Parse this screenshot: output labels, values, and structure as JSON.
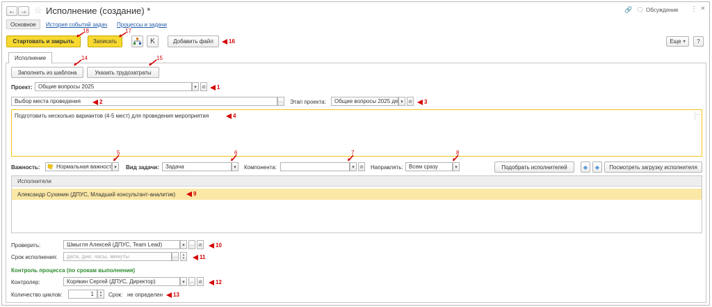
{
  "window": {
    "title": "Исполнение (создание) *",
    "discussion_label": "Обсуждение"
  },
  "nav_tabs": [
    {
      "label": "Основное"
    },
    {
      "label": "История событий задач"
    },
    {
      "label": "Процессы и задачи"
    }
  ],
  "toolbar": {
    "start_close_label": "Стартовать и закрыть",
    "save_label": "Записать",
    "k_label": "K",
    "add_file_label": "Добавить файл",
    "more_label": "Еще",
    "help_label": "?"
  },
  "form_tab": {
    "label": "Исполнение"
  },
  "buttons": {
    "fill_template": "Заполнить из шаблона",
    "labor_costs": "Указать трудозатраты",
    "pick_executors": "Подобрать исполнителей",
    "view_load": "Посмотреть загрузку исполнителя"
  },
  "fields": {
    "project_label": "Проект:",
    "project_value": "Общие вопросы 2025",
    "task_name_value": "Выбор места проведения",
    "project_stage_label": "Этап проекта:",
    "project_stage_value": "Общие вопросы 2025 де",
    "description_value": "Подготовить несколько вариантов (4-5 мест) для проведения мероприятия",
    "importance_label": "Важность:",
    "importance_value": "Нормальная важност",
    "task_type_label": "Вид задачи:",
    "task_type_value": "Задача",
    "component_label": "Компонента:",
    "component_value": "",
    "direct_label": "Направлять:",
    "direct_value": "Всем сразу",
    "check_label": "Проверить:",
    "check_value": "Шмыгля Алексей (ДПУС, Team Lead)",
    "deadline_label": "Срок исполнения:",
    "deadline_placeholder": "дата, дни, часы, минуты",
    "control_section": "Контроль процесса (по срокам выполнения)",
    "controller_label": "Контролер:",
    "controller_value": "Корякин Сергей (ДПУС, Директор)",
    "cycles_label": "Количество циклов:",
    "cycles_value": "1",
    "term_label": "Срок:",
    "term_value": "не определен"
  },
  "executors": {
    "header": "Исполнители",
    "rows": [
      {
        "text": "Александр Сухинин (ДПУС, Младший консультант-аналитик)"
      }
    ]
  },
  "markers": {
    "m1": "1",
    "m2": "2",
    "m3": "3",
    "m4": "4",
    "m5": "5",
    "m6": "6",
    "m7": "7",
    "m8": "8",
    "m9": "9",
    "m10": "10",
    "m11": "11",
    "m12": "12",
    "m13": "13",
    "m14": "14",
    "m15": "15",
    "m16": "16",
    "m17": "17",
    "m18": "18"
  },
  "colors": {
    "accent_yellow": "#f7d931",
    "marker_red": "#d40000",
    "selected_row": "#fbe7a6",
    "section_green": "#2e8b2e",
    "link_blue": "#1f5aa6"
  }
}
